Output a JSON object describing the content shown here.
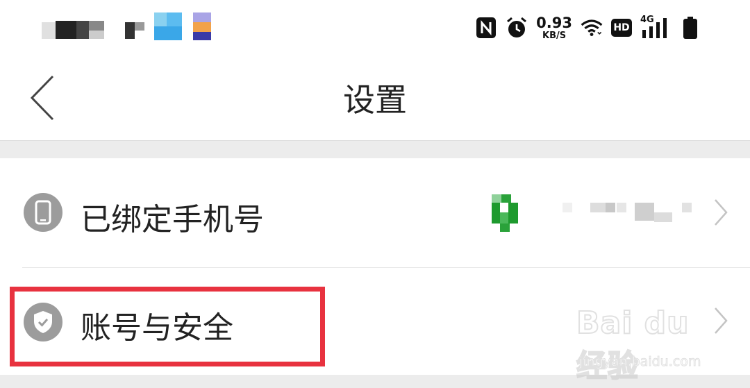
{
  "status_bar": {
    "net_speed_value": "0.93",
    "net_speed_unit": "KB/S",
    "hd_label": "HD",
    "network_label": "4G",
    "icons": [
      "nfc-icon",
      "alarm-icon",
      "wifi-icon",
      "hd-icon",
      "signal-icon",
      "battery-icon"
    ]
  },
  "nav": {
    "back_icon": "chevron-left-icon",
    "title": "设置"
  },
  "settings": {
    "items": [
      {
        "label": "已绑定手机号",
        "icon": "phone-icon"
      },
      {
        "label": "账号与安全",
        "icon": "shield-check-icon"
      }
    ]
  },
  "watermark": {
    "brand": "Bai du经验",
    "url": "jingyan.baidu.com"
  },
  "colors": {
    "highlight": "#e8323f",
    "icon_gray": "#9c9c9c",
    "page_gray": "#ececec"
  }
}
